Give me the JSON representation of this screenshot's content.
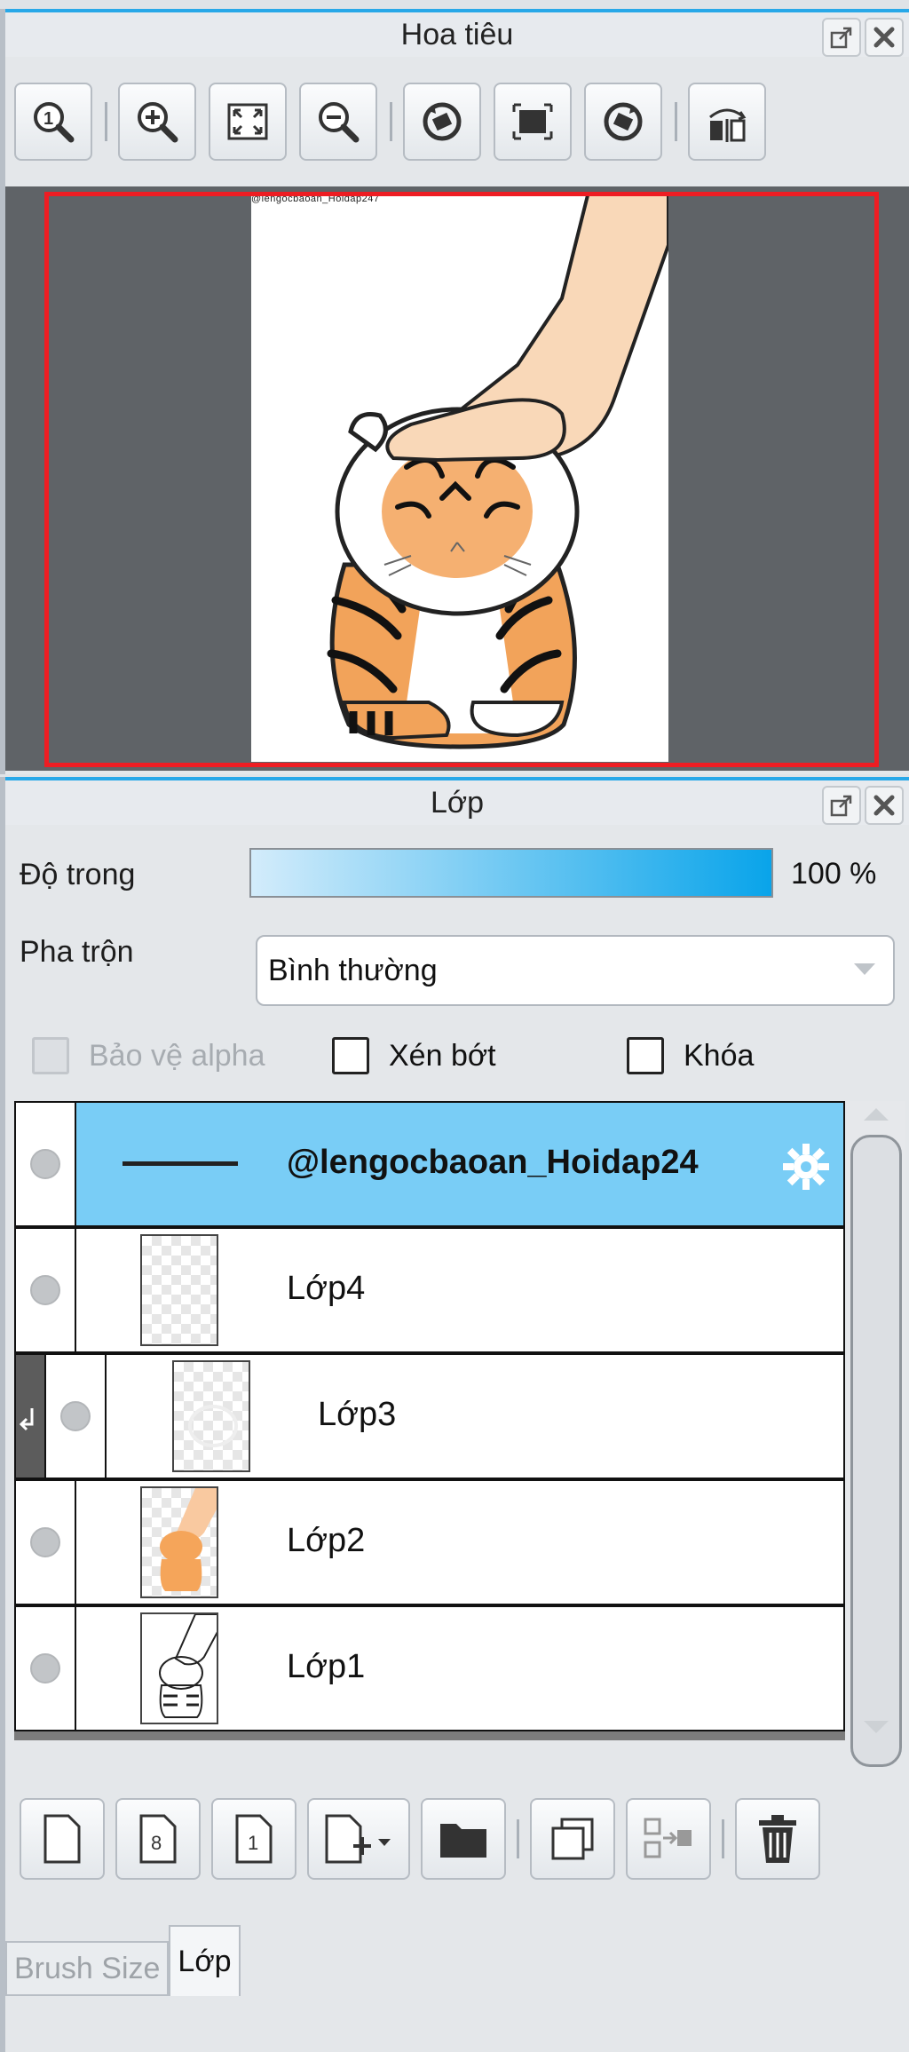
{
  "navigator": {
    "title": "Hoa tiêu",
    "watermark": "@lengocbaoan_Hoidap247"
  },
  "layers_panel": {
    "title": "Lớp",
    "opacity_label": "Độ trong",
    "opacity_value": "100 %",
    "opacity_fraction": 1.0,
    "blend_label": "Pha trộn",
    "blend_value": "Bình thường",
    "protect_alpha_label": "Bảo vệ alpha",
    "clip_label": "Xén bớt",
    "lock_label": "Khóa",
    "layers": [
      {
        "name": "@lengocbaoan_Hoidap24",
        "selected": true
      },
      {
        "name": "Lớp4"
      },
      {
        "name": "Lớp3",
        "clipped": true
      },
      {
        "name": "Lớp2"
      },
      {
        "name": "Lớp1"
      }
    ]
  },
  "tabs": {
    "brush_size": "Brush Size",
    "layer": "Lớp"
  },
  "colors": {
    "accent": "#28a8e8",
    "selected_row": "#79cdf6",
    "preview_frame": "#ee1d23",
    "preview_bg": "#5f6367"
  }
}
